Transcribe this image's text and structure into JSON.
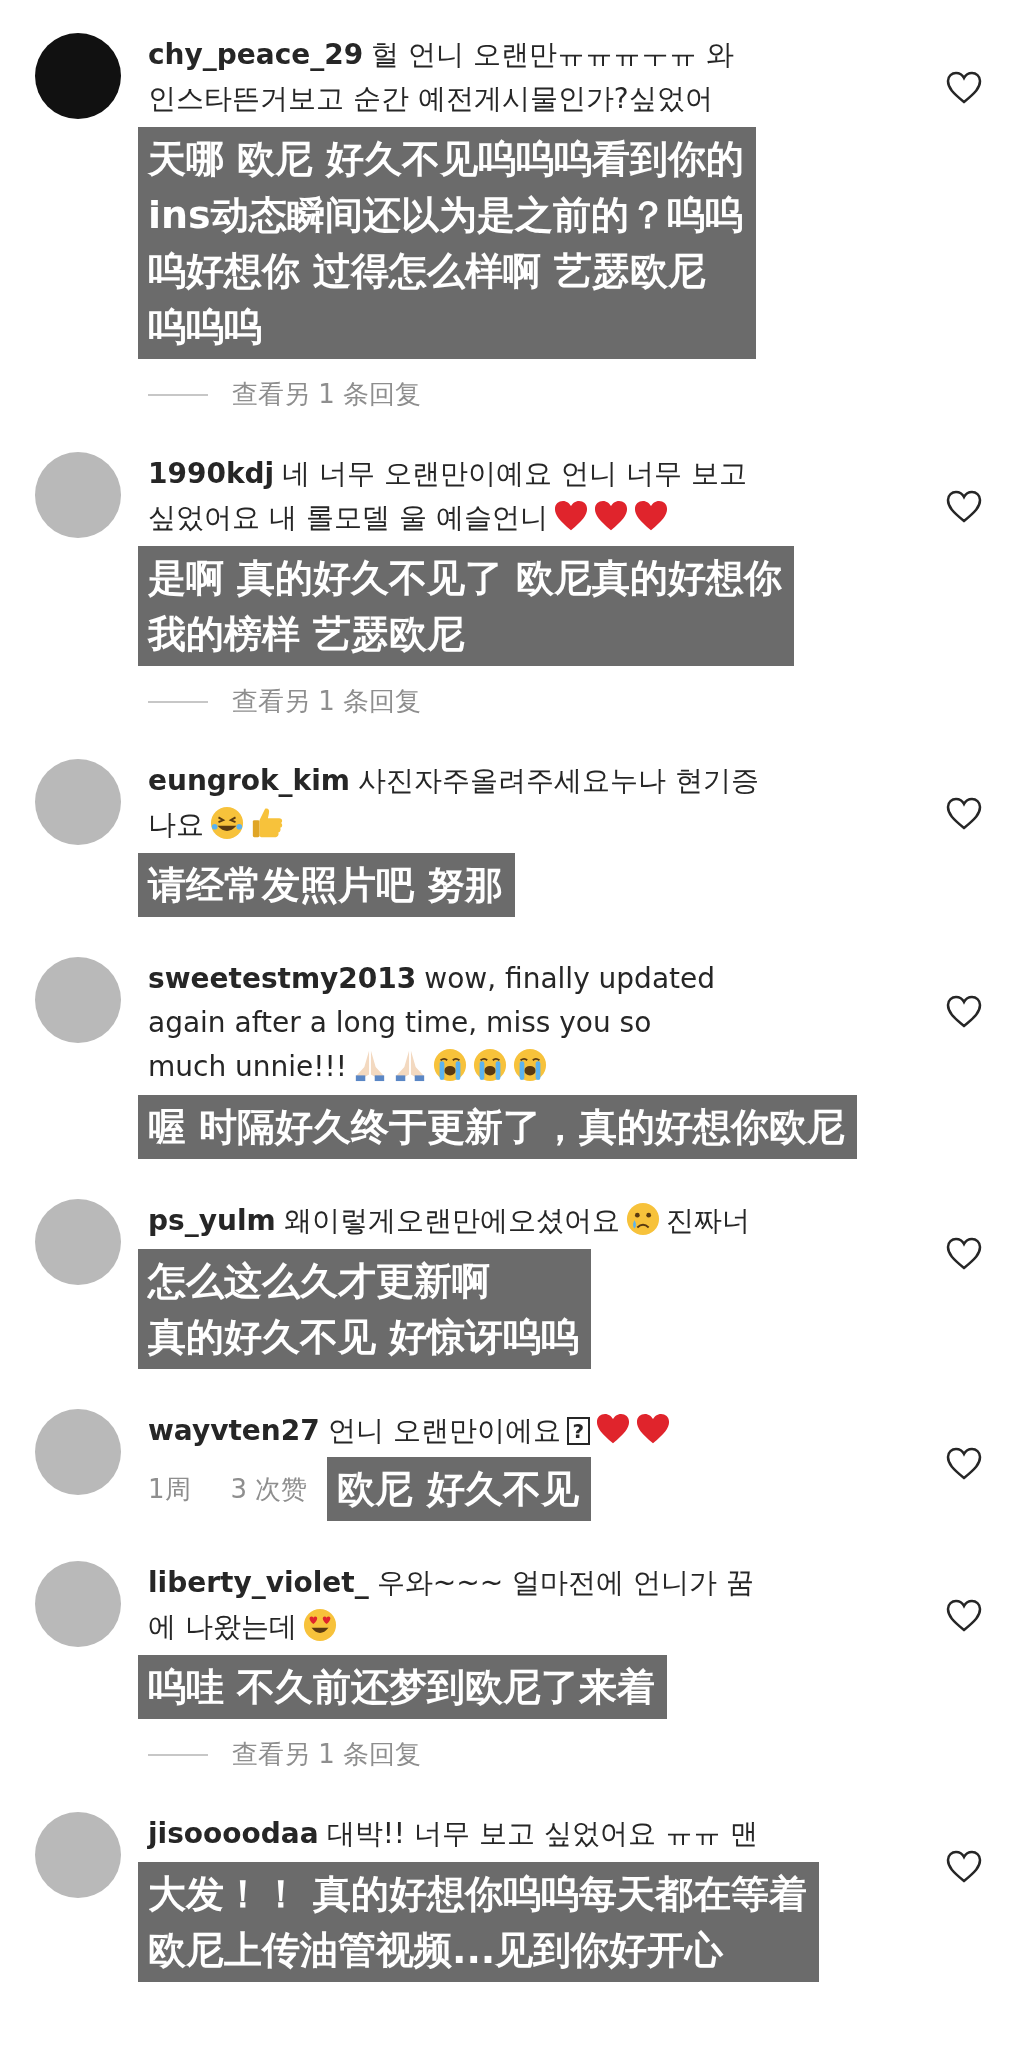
{
  "comments": [
    {
      "username": "chy_peace_29",
      "lines": [
        [
          {
            "kind": "text",
            "text": "헐 언니 오랜만ㅠㅠㅠㅜㅠ 와"
          }
        ],
        [
          {
            "kind": "text",
            "text": "인스타뜬거보고 순간 예전게시물인가?싶었어"
          }
        ]
      ],
      "subtitle": [
        "天哪 欧尼 好久不见呜呜呜看到你的",
        "ins动态瞬间还以为是之前的？呜呜",
        "呜好想你 过得怎么样啊 艺瑟欧尼",
        "呜呜呜"
      ],
      "replies_link": "查看另 1 条回复"
    },
    {
      "username": "1990kdj",
      "lines": [
        [
          {
            "kind": "text",
            "text": "네 너무 오랜만이예요  언니 너무 보고"
          }
        ],
        [
          {
            "kind": "text",
            "text": "싶었어요 내 롤모델 울 예슬언니"
          },
          {
            "kind": "heart"
          },
          {
            "kind": "heart"
          },
          {
            "kind": "heart"
          }
        ]
      ],
      "subtitle": [
        "是啊 真的好久不见了 欧尼真的好想你",
        "我的榜样 艺瑟欧尼"
      ],
      "replies_link": "查看另 1 条回复"
    },
    {
      "username": "eungrok_kim",
      "lines": [
        [
          {
            "kind": "text",
            "text": "사진자주올려주세요누나 현기증"
          }
        ],
        [
          {
            "kind": "text",
            "text": "나요"
          },
          {
            "kind": "laugh"
          },
          {
            "kind": "thumbs"
          }
        ]
      ],
      "subtitle": [
        "请经常发照片吧  努那"
      ]
    },
    {
      "username": "sweetestmy2013",
      "lines": [
        [
          {
            "kind": "text",
            "text": "wow, finally updated"
          }
        ],
        [
          {
            "kind": "text",
            "text": "again after a long time, miss you so"
          }
        ],
        [
          {
            "kind": "text",
            "text": "much unnie!!!"
          },
          {
            "kind": "pray"
          },
          {
            "kind": "pray"
          },
          {
            "kind": "sob"
          },
          {
            "kind": "sob"
          },
          {
            "kind": "sob"
          }
        ]
      ],
      "subtitle": [
        "喔  时隔好久终于更新了，真的好想你欧尼"
      ]
    },
    {
      "username": "ps_yulm",
      "lines": [
        [
          {
            "kind": "text",
            "text": "왜이렇게오랜만에오셨어요"
          },
          {
            "kind": "tear"
          },
          {
            "kind": "text",
            "text": "진짜너"
          }
        ]
      ],
      "subtitle": [
        "怎么这么久才更新啊",
        "真的好久不见 好惊讶呜呜"
      ]
    },
    {
      "username": "wayvten27",
      "lines": [
        [
          {
            "kind": "text",
            "text": "언니 오랜만이에요"
          },
          {
            "kind": "missing",
            "text": "?"
          },
          {
            "kind": "heart"
          },
          {
            "kind": "heart"
          }
        ]
      ],
      "time": "1周",
      "likes": "3 次赞",
      "subtitle": [
        "欧尼 好久不见"
      ]
    },
    {
      "username": "liberty_violet_",
      "lines": [
        [
          {
            "kind": "text",
            "text": "우와~~~ 얼마전에 언니가 꿈"
          }
        ],
        [
          {
            "kind": "text",
            "text": "에 나왔는데"
          },
          {
            "kind": "heart_eyes"
          }
        ]
      ],
      "subtitle": [
        "呜哇 不久前还梦到欧尼了来着"
      ],
      "replies_link": "查看另 1 条回复"
    },
    {
      "username": "jisoooodaa",
      "lines": [
        [
          {
            "kind": "text",
            "text": "대박!! 너무 보고 싶었어요 ㅠㅠ 맨"
          }
        ]
      ],
      "subtitle": [
        "大发！！ 真的好想你呜呜每天都在等着",
        "欧尼上传油管视频...见到你好开心"
      ]
    }
  ]
}
